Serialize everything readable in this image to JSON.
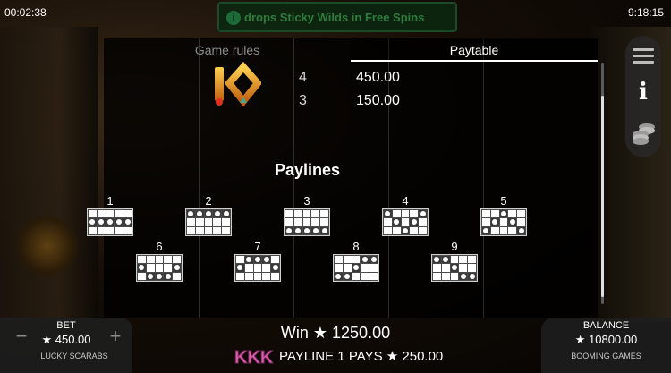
{
  "status": {
    "elapsed": "00:02:38",
    "clock": "9:18:15"
  },
  "banner": {
    "text": "drops Sticky Wilds in Free Spins",
    "icon": "info-circle-icon"
  },
  "tabs": [
    {
      "label": "Game rules",
      "active": false
    },
    {
      "label": "Paytable",
      "active": true
    }
  ],
  "paytable": {
    "symbol": "10",
    "rows": [
      {
        "count": "4",
        "amount": "450.00"
      },
      {
        "count": "3",
        "amount": "150.00"
      }
    ]
  },
  "paylines": {
    "title": "Paylines",
    "lines": [
      {
        "num": "1",
        "rows": [
          1,
          1,
          1,
          1,
          1
        ]
      },
      {
        "num": "2",
        "rows": [
          0,
          0,
          0,
          0,
          0
        ]
      },
      {
        "num": "3",
        "rows": [
          2,
          2,
          2,
          2,
          2
        ]
      },
      {
        "num": "4",
        "rows": [
          0,
          1,
          2,
          1,
          0
        ]
      },
      {
        "num": "5",
        "rows": [
          2,
          1,
          0,
          1,
          2
        ]
      },
      {
        "num": "6",
        "rows": [
          1,
          2,
          2,
          2,
          1
        ]
      },
      {
        "num": "7",
        "rows": [
          1,
          0,
          0,
          0,
          1
        ]
      },
      {
        "num": "8",
        "rows": [
          2,
          2,
          1,
          0,
          0
        ]
      },
      {
        "num": "9",
        "rows": [
          0,
          0,
          1,
          2,
          2
        ]
      }
    ]
  },
  "scroll": {
    "position": 0.83
  },
  "side_menu": {
    "icons": [
      "menu-icon",
      "info-icon",
      "coins-icon"
    ]
  },
  "bet": {
    "label": "BET",
    "value": "★ 450.00",
    "minus": "−",
    "plus": "+"
  },
  "game_name": "LUCKY SCARABS",
  "win": {
    "text": "Win ★ 1250.00"
  },
  "payline_pays": {
    "symbols": "KKK",
    "text": "PAYLINE 1 PAYS ★ 250.00"
  },
  "balance": {
    "label": "BALANCE",
    "value": "★ 10800.00"
  },
  "brand": "BOOMING GAMES",
  "colors": {
    "accent_gold": "#f0a020",
    "banner_green": "#2e7d3e",
    "k_pink": "#e060b0"
  }
}
